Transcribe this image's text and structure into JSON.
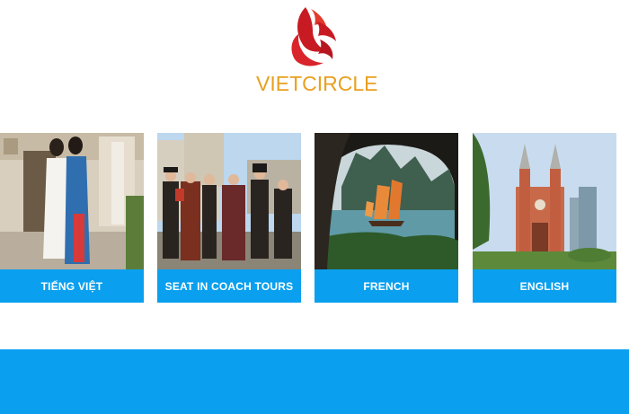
{
  "brand": {
    "name": "VIETCIRCLE",
    "colors": {
      "primary_red": "#d8242a",
      "gold": "#e8a020",
      "accent_blue": "#0aa0ef"
    }
  },
  "cards": [
    {
      "label": "TIẾNG VIỆT",
      "image": "women-in-ao-dai"
    },
    {
      "label": "SEAT IN COACH TOURS",
      "image": "group-in-costumes"
    },
    {
      "label": "FRENCH",
      "image": "ha-long-bay-junk-boat"
    },
    {
      "label": "ENGLISH",
      "image": "saigon-notre-dame-cathedral"
    }
  ]
}
